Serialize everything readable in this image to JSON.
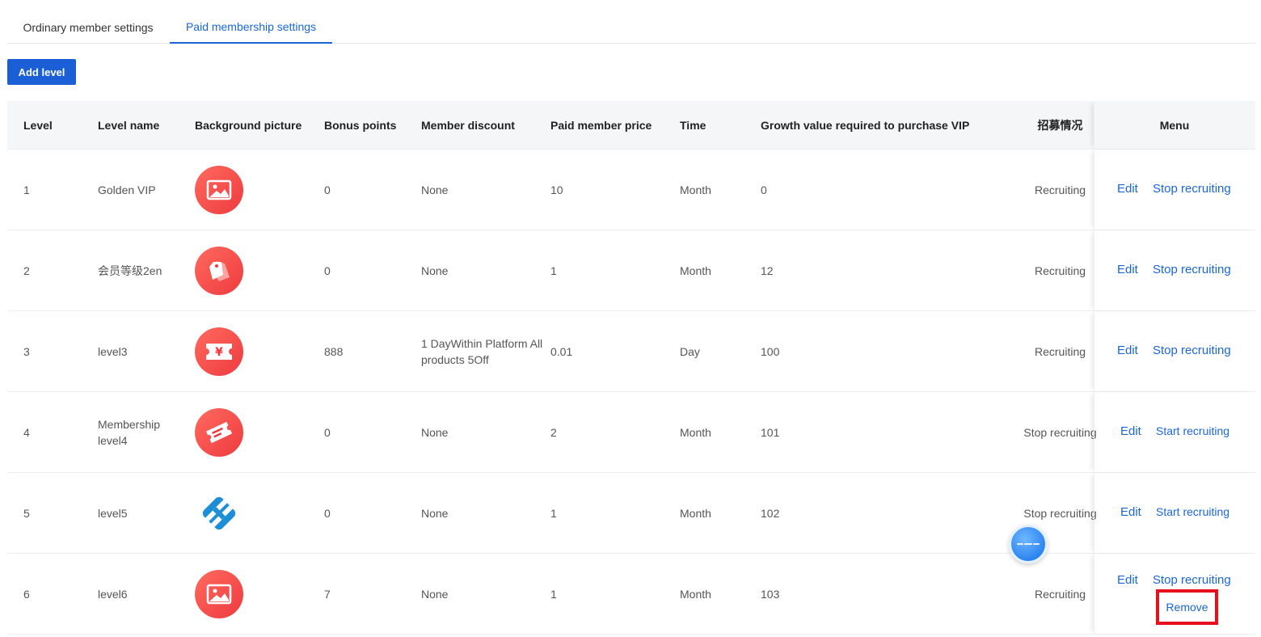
{
  "tabs": [
    {
      "label": "Ordinary member settings",
      "active": false
    },
    {
      "label": "Paid membership settings",
      "active": true
    }
  ],
  "add_button": "Add level",
  "columns": [
    "Level",
    "Level name",
    "Background picture",
    "Bonus points",
    "Member discount",
    "Paid member price",
    "Time",
    "Growth value required to purchase VIP",
    "招募情况",
    "Menu"
  ],
  "rows": [
    {
      "level": "1",
      "name": "Golden VIP",
      "icon": "image-icon",
      "bonus": "0",
      "discount": "None",
      "price": "10",
      "time": "Month",
      "growth": "0",
      "status": "Recruiting",
      "edit": "Edit",
      "toggle": "Stop recruiting"
    },
    {
      "level": "2",
      "name": "会员等级2en",
      "icon": "tag-icon",
      "bonus": "0",
      "discount": "None",
      "price": "1",
      "time": "Month",
      "growth": "12",
      "status": "Recruiting",
      "edit": "Edit",
      "toggle": "Stop recruiting"
    },
    {
      "level": "3",
      "name": "level3",
      "icon": "yuan-ticket-icon",
      "bonus": "888",
      "discount": "1 DayWithin Platform All products 5Off",
      "price": "0.01",
      "time": "Day",
      "growth": "100",
      "status": "Recruiting",
      "edit": "Edit",
      "toggle": "Stop recruiting"
    },
    {
      "level": "4",
      "name": "Membership level4",
      "icon": "ticket-icon",
      "bonus": "0",
      "discount": "None",
      "price": "2",
      "time": "Month",
      "growth": "101",
      "status": "Stop recruiting",
      "edit": "Edit",
      "toggle": "Start recruiting"
    },
    {
      "level": "5",
      "name": "level5",
      "icon": "app-logo-icon",
      "bonus": "0",
      "discount": "None",
      "price": "1",
      "time": "Month",
      "growth": "102",
      "status": "Stop recruiting",
      "edit": "Edit",
      "toggle": "Start recruiting"
    },
    {
      "level": "6",
      "name": "level6",
      "icon": "image-icon",
      "bonus": "7",
      "discount": "None",
      "price": "1",
      "time": "Month",
      "growth": "103",
      "status": "Recruiting",
      "edit": "Edit",
      "toggle": "Stop recruiting",
      "remove": "Remove"
    }
  ],
  "colors": {
    "accent": "#1a66d9",
    "button": "#1a5fd6",
    "highlight": "#e8101c",
    "thumb": "#ee3a3f"
  }
}
